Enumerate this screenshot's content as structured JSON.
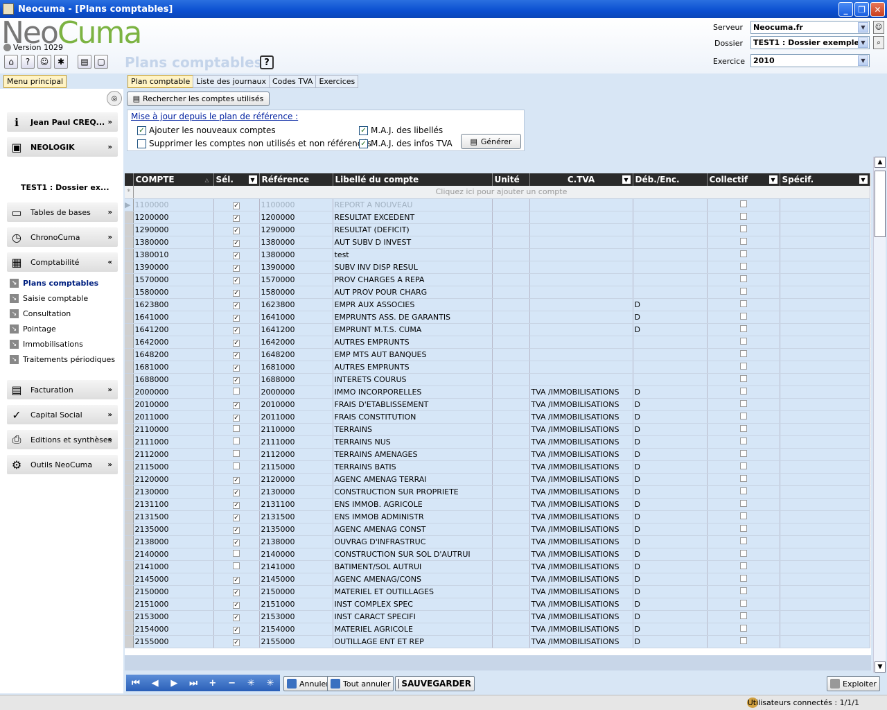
{
  "window": {
    "title": "Neocuma - [Plans comptables]"
  },
  "header": {
    "logo_neo": "Neo",
    "logo_cuma": "Cuma",
    "version": "Version 1029",
    "page_title": "Plans comptables",
    "help": "?",
    "serveur_label": "Serveur",
    "serveur_value": "Neocuma.fr",
    "dossier_label": "Dossier",
    "dossier_value": "TEST1 : Dossier exemple",
    "exercice_label": "Exercice",
    "exercice_value": "2010"
  },
  "tabs": {
    "menu": "Menu principal",
    "main": [
      "Plan comptable",
      "Liste des journaux",
      "Codes TVA",
      "Exercices"
    ]
  },
  "sidebar": {
    "user": "Jean Paul CREQ...",
    "company": "NEOLOGIK",
    "dossier": "TEST1 : Dossier ex...",
    "modules": [
      {
        "label": "Tables de bases",
        "chev": "»"
      },
      {
        "label": "ChronoCuma",
        "chev": "»"
      },
      {
        "label": "Comptabilité",
        "chev": "«"
      },
      {
        "label": "Facturation",
        "chev": "»"
      },
      {
        "label": "Capital Social",
        "chev": "»"
      },
      {
        "label": "Editions et synthèses",
        "chev": "»"
      },
      {
        "label": "Outils NeoCuma",
        "chev": "»"
      }
    ],
    "sub_items": [
      "Plans comptables",
      "Saisie comptable",
      "Consultation",
      "Pointage",
      "Immobilisations",
      "Traitements périodiques"
    ]
  },
  "main": {
    "search_button": "Rechercher les comptes utilisés",
    "update_title": "Mise à jour depuis le plan de référence :",
    "opt_add": "Ajouter les nouveaux comptes",
    "opt_delete": "Supprimer les comptes non utilisés et non référencés",
    "opt_labels": "M.A.J. des libellés",
    "opt_tva": "M.A.J. des infos TVA",
    "generate": "Générer"
  },
  "grid": {
    "columns": [
      "COMPTE",
      "Sél.",
      "Référence",
      "Libellé du compte",
      "Unité",
      "C.TVA",
      "Déb./Enc.",
      "Collectif",
      "Spécif."
    ],
    "add_row_hint": "Cliquez ici pour ajouter un compte",
    "rows": [
      {
        "compte": "1100000",
        "sel": true,
        "ref": "1100000",
        "libelle": "REPORT A NOUVEAU",
        "tva": "",
        "deb": ""
      },
      {
        "compte": "1200000",
        "sel": true,
        "ref": "1200000",
        "libelle": "RESULTAT EXCEDENT",
        "tva": "",
        "deb": ""
      },
      {
        "compte": "1290000",
        "sel": true,
        "ref": "1290000",
        "libelle": "RESULTAT (DEFICIT)",
        "tva": "",
        "deb": ""
      },
      {
        "compte": "1380000",
        "sel": true,
        "ref": "1380000",
        "libelle": "AUT SUBV D INVEST",
        "tva": "",
        "deb": ""
      },
      {
        "compte": "1380010",
        "sel": true,
        "ref": "1380000",
        "libelle": "test",
        "tva": "",
        "deb": ""
      },
      {
        "compte": "1390000",
        "sel": true,
        "ref": "1390000",
        "libelle": "SUBV INV DISP RESUL",
        "tva": "",
        "deb": ""
      },
      {
        "compte": "1570000",
        "sel": true,
        "ref": "1570000",
        "libelle": "PROV CHARGES A REPA",
        "tva": "",
        "deb": ""
      },
      {
        "compte": "1580000",
        "sel": true,
        "ref": "1580000",
        "libelle": "AUT PROV POUR CHARG",
        "tva": "",
        "deb": ""
      },
      {
        "compte": "1623800",
        "sel": true,
        "ref": "1623800",
        "libelle": "EMPR AUX ASSOCIES",
        "tva": "",
        "deb": "D"
      },
      {
        "compte": "1641000",
        "sel": true,
        "ref": "1641000",
        "libelle": "EMPRUNTS ASS. DE GARANTIS",
        "tva": "",
        "deb": "D"
      },
      {
        "compte": "1641200",
        "sel": true,
        "ref": "1641200",
        "libelle": "EMPRUNT M.T.S. CUMA",
        "tva": "",
        "deb": "D"
      },
      {
        "compte": "1642000",
        "sel": true,
        "ref": "1642000",
        "libelle": "AUTRES EMPRUNTS",
        "tva": "",
        "deb": ""
      },
      {
        "compte": "1648200",
        "sel": true,
        "ref": "1648200",
        "libelle": "EMP MTS AUT BANQUES",
        "tva": "",
        "deb": ""
      },
      {
        "compte": "1681000",
        "sel": true,
        "ref": "1681000",
        "libelle": "AUTRES EMPRUNTS",
        "tva": "",
        "deb": ""
      },
      {
        "compte": "1688000",
        "sel": true,
        "ref": "1688000",
        "libelle": "INTERETS COURUS",
        "tva": "",
        "deb": ""
      },
      {
        "compte": "2000000",
        "sel": false,
        "ref": "2000000",
        "libelle": "IMMO INCORPORELLES",
        "tva": "TVA /IMMOBILISATIONS",
        "deb": "D"
      },
      {
        "compte": "2010000",
        "sel": true,
        "ref": "2010000",
        "libelle": "FRAIS D'ETABLISSEMENT",
        "tva": "TVA /IMMOBILISATIONS",
        "deb": "D"
      },
      {
        "compte": "2011000",
        "sel": true,
        "ref": "2011000",
        "libelle": "FRAIS CONSTITUTION",
        "tva": "TVA /IMMOBILISATIONS",
        "deb": "D"
      },
      {
        "compte": "2110000",
        "sel": false,
        "ref": "2110000",
        "libelle": "TERRAINS",
        "tva": "TVA /IMMOBILISATIONS",
        "deb": "D"
      },
      {
        "compte": "2111000",
        "sel": false,
        "ref": "2111000",
        "libelle": "TERRAINS NUS",
        "tva": "TVA /IMMOBILISATIONS",
        "deb": "D"
      },
      {
        "compte": "2112000",
        "sel": false,
        "ref": "2112000",
        "libelle": "TERRAINS AMENAGES",
        "tva": "TVA /IMMOBILISATIONS",
        "deb": "D"
      },
      {
        "compte": "2115000",
        "sel": false,
        "ref": "2115000",
        "libelle": "TERRAINS BATIS",
        "tva": "TVA /IMMOBILISATIONS",
        "deb": "D"
      },
      {
        "compte": "2120000",
        "sel": true,
        "ref": "2120000",
        "libelle": "AGENC AMENAG TERRAI",
        "tva": "TVA /IMMOBILISATIONS",
        "deb": "D"
      },
      {
        "compte": "2130000",
        "sel": true,
        "ref": "2130000",
        "libelle": "CONSTRUCTION SUR PROPRIETE",
        "tva": "TVA /IMMOBILISATIONS",
        "deb": "D"
      },
      {
        "compte": "2131100",
        "sel": true,
        "ref": "2131100",
        "libelle": "ENS IMMOB. AGRICOLE",
        "tva": "TVA /IMMOBILISATIONS",
        "deb": "D"
      },
      {
        "compte": "2131500",
        "sel": true,
        "ref": "2131500",
        "libelle": "ENS IMMOB ADMINISTR",
        "tva": "TVA /IMMOBILISATIONS",
        "deb": "D"
      },
      {
        "compte": "2135000",
        "sel": true,
        "ref": "2135000",
        "libelle": "AGENC AMENAG CONST",
        "tva": "TVA /IMMOBILISATIONS",
        "deb": "D"
      },
      {
        "compte": "2138000",
        "sel": true,
        "ref": "2138000",
        "libelle": "OUVRAG D'INFRASTRUC",
        "tva": "TVA /IMMOBILISATIONS",
        "deb": "D"
      },
      {
        "compte": "2140000",
        "sel": false,
        "ref": "2140000",
        "libelle": "CONSTRUCTION SUR SOL D'AUTRUI",
        "tva": "TVA /IMMOBILISATIONS",
        "deb": "D"
      },
      {
        "compte": "2141000",
        "sel": false,
        "ref": "2141000",
        "libelle": "BATIMENT/SOL AUTRUI",
        "tva": "TVA /IMMOBILISATIONS",
        "deb": "D"
      },
      {
        "compte": "2145000",
        "sel": true,
        "ref": "2145000",
        "libelle": "AGENC AMENAG/CONS",
        "tva": "TVA /IMMOBILISATIONS",
        "deb": "D"
      },
      {
        "compte": "2150000",
        "sel": true,
        "ref": "2150000",
        "libelle": "MATERIEL ET OUTILLAGES",
        "tva": "TVA /IMMOBILISATIONS",
        "deb": "D"
      },
      {
        "compte": "2151000",
        "sel": true,
        "ref": "2151000",
        "libelle": "INST COMPLEX SPEC",
        "tva": "TVA /IMMOBILISATIONS",
        "deb": "D"
      },
      {
        "compte": "2153000",
        "sel": true,
        "ref": "2153000",
        "libelle": "INST CARACT SPECIFI",
        "tva": "TVA /IMMOBILISATIONS",
        "deb": "D"
      },
      {
        "compte": "2154000",
        "sel": true,
        "ref": "2154000",
        "libelle": "MATERIEL AGRICOLE",
        "tva": "TVA /IMMOBILISATIONS",
        "deb": "D"
      },
      {
        "compte": "2155000",
        "sel": true,
        "ref": "2155000",
        "libelle": "OUTILLAGE ENT ET REP",
        "tva": "TVA /IMMOBILISATIONS",
        "deb": "D"
      }
    ]
  },
  "navbar": {
    "annuler": "Annuler",
    "tout_annuler": "Tout annuler",
    "sauvegarder": "SAUVEGARDER",
    "exploiter": "Exploiter"
  },
  "status": {
    "users": "Utilisateurs connectés : 1/1/1"
  }
}
